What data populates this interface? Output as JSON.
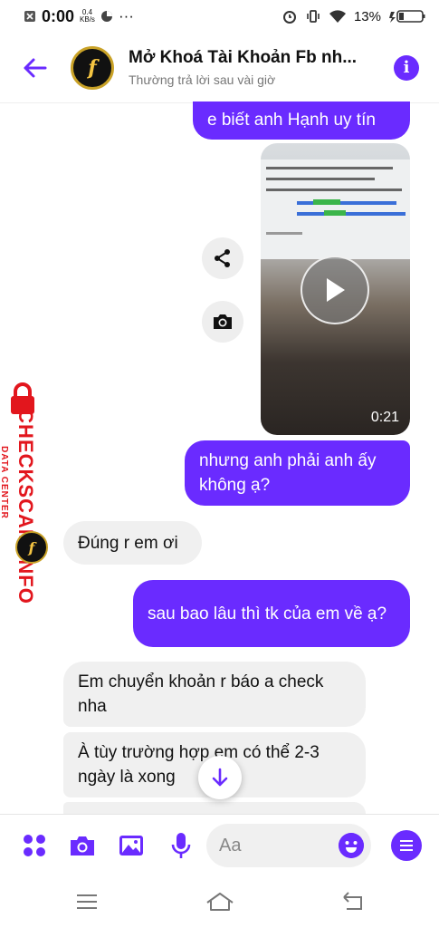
{
  "status_bar": {
    "time": "0:00",
    "speed_value": "0.4",
    "speed_unit": "KB/s",
    "overflow": "···",
    "battery": "13%"
  },
  "header": {
    "title": "Mở Khoá Tài Khoản Fb nh...",
    "subtitle": "Thường trả lời sau vài giờ",
    "avatar_letter": "f",
    "info_label": "i"
  },
  "messages": [
    {
      "side": "out",
      "text": "e biết anh Hạnh uy tín"
    },
    {
      "side": "out",
      "type": "video",
      "duration": "0:21"
    },
    {
      "side": "out",
      "text": "nhưng anh phải anh ấy không ạ?"
    },
    {
      "side": "in",
      "text": "Đúng r em ơi"
    },
    {
      "side": "out",
      "text": "sau bao lâu thì tk của em về ạ?"
    },
    {
      "side": "in",
      "text": "Em chuyển khoản r báo a check nha"
    },
    {
      "side": "in",
      "text": "À tùy trường hợp em có thể 2-3 ngày là xong"
    }
  ],
  "watermark": {
    "big": "CHECKSCAM.INFO",
    "small": "DATA CENTER"
  },
  "composer": {
    "placeholder": "Aa"
  },
  "colors": {
    "accent": "#6a2bff",
    "incoming_bubble": "#f0f0f0",
    "watermark": "#e2161d"
  },
  "icons": [
    "back-arrow-icon",
    "info-icon",
    "share-icon",
    "camera-icon",
    "play-icon",
    "down-arrow-icon",
    "apps-icon",
    "gallery-icon",
    "mic-icon",
    "emoji-icon",
    "menu-icon",
    "lock-icon"
  ]
}
